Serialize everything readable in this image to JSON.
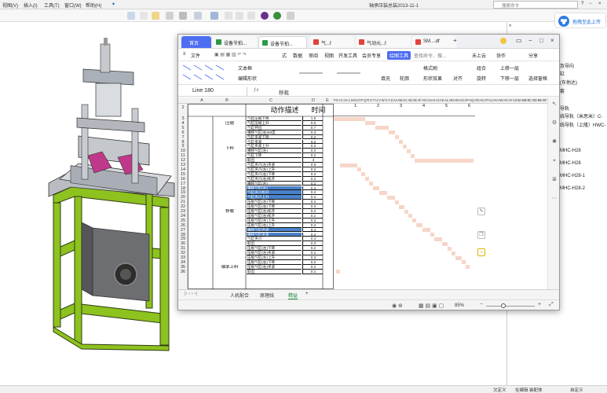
{
  "cad": {
    "menubar": {
      "items": [
        "视图(V)",
        "插入(I)",
        "工具(T)",
        "窗口(W)",
        "帮助(H)"
      ],
      "title": "轴承压装总装2013-11-1",
      "search_placeholder": "搜索命令"
    },
    "right_panel": {
      "upload_label": "拖拽至此上传",
      "tree_items": [
        "及导向",
        "缸",
        "(东他达)",
        "套",
        "导轨",
        "线导轨（米思米）C-",
        "线导轨（上隆）HWC-",
        "MHC-H28",
        "MHC-H28",
        "MHC-H28-1",
        "MHC-H28-2"
      ]
    },
    "statusbar": {
      "items": [
        "欠定义",
        "在编辑 装配体",
        "自定义"
      ]
    }
  },
  "wps": {
    "tabs": [
      {
        "label": "首页",
        "active": true
      },
      {
        "label": "设备节拍...",
        "color": "#2b9a49"
      },
      {
        "label": "设备节拍...",
        "color": "#2b9a49"
      },
      {
        "label": "气...f",
        "color": "#e0443a"
      },
      {
        "label": "气动元...f",
        "color": "#e0443a"
      },
      {
        "label": "SM....df",
        "color": "#e0443a"
      }
    ],
    "add_tab_label": "+",
    "menu": {
      "file": "文件",
      "items": [
        "式",
        "数据",
        "审阅",
        "视图",
        "开发工具",
        "会员专享"
      ],
      "drawing_tools": "绘图工具",
      "search_placeholder": "查找命令、搜...",
      "cloud": "未上云",
      "collab": "协作",
      "share": "分享"
    },
    "drawtools": {
      "textbox": "文本框",
      "edit_shape": "编辑形状",
      "fill": "填充",
      "outline": "轮廓",
      "format_painter": "格式刷",
      "shape_effect": "形状效果",
      "align": "对齐",
      "group": "组合",
      "rotate": "旋转",
      "bring_forward": "上移一层",
      "send_backward": "下移一层",
      "selection_pane": "选择窗格"
    },
    "formula_bar": {
      "name_box": "Line 180",
      "content": "移载"
    },
    "columns": [
      "A",
      "B",
      "C",
      "D",
      "E"
    ],
    "ruler_text": "FG H I J K L M N O P Q R S T U V W X Y Z AA AB AC AD AE AF AG AH AI AJ AK AL AM AN AO AP AQ AR AS AT AU AV AW AX AY AZ BA BB BC BD BE BF BG BH BI BJ BK BL BM BN BO BP BQ BR BS BT BU BV BW BX BY BZ CA CB CC CD CE CF CG CH CI CJ",
    "headers": {
      "action": "动作描述",
      "time": "时间"
    },
    "sections": [
      "压缩",
      "下料",
      "移载",
      "轴承上料"
    ],
    "rows": [
      {
        "n": "3",
        "desc": "气缸压缩下降",
        "time": "1.6"
      },
      {
        "n": "4",
        "desc": "气缸压缩上升",
        "time": "0.5"
      },
      {
        "n": "5",
        "desc": "气缸伸出",
        "time": "0.7"
      },
      {
        "n": "6",
        "desc": "横移气缸(右)90度",
        "time": "0.3"
      },
      {
        "n": "7",
        "desc": "气缸夹紧下降",
        "time": "0.2"
      },
      {
        "n": "8",
        "desc": "气缸夹紧",
        "time": "0.2"
      },
      {
        "n": "9",
        "desc": "气缸夹紧上升",
        "time": "0.2"
      },
      {
        "n": "10",
        "desc": "横移气缸(左)",
        "time": "0.2"
      },
      {
        "n": "11",
        "desc": "气缸下降",
        "time": "0.2"
      },
      {
        "n": "12",
        "desc": "取出",
        "time": "3"
      },
      {
        "n": "13",
        "desc": "气缸夹爪(左)夹紧",
        "time": "0.9"
      },
      {
        "n": "14",
        "desc": "气缸夹爪(左)上升",
        "time": "0.2"
      },
      {
        "n": "15",
        "desc": "气缸夹爪(右)下降",
        "time": "0.2"
      },
      {
        "n": "16",
        "desc": "气缸夹爪(右)松开",
        "time": "0.2"
      },
      {
        "n": "17",
        "desc": "横移气缸(右)",
        "time": "0.2"
      },
      {
        "n": "18",
        "desc": "横移气缸(左)",
        "time": "0.3",
        "highlight": true
      },
      {
        "n": "19",
        "desc": "气缸夹爪松开",
        "time": "0.4",
        "highlight": true
      },
      {
        "n": "20",
        "desc": "气缸夹爪上升",
        "time": "0.4",
        "highlight": true
      },
      {
        "n": "21",
        "desc": "压板气缸(左)下降",
        "time": "0.2"
      },
      {
        "n": "22",
        "desc": "压板气缸(右)下降",
        "time": "0.3"
      },
      {
        "n": "23",
        "desc": "压板气缸(左)松开",
        "time": "0.2"
      },
      {
        "n": "24",
        "desc": "压板气缸(右)松开",
        "time": "0.2"
      },
      {
        "n": "25",
        "desc": "压板气缸(左)上升",
        "time": "0.2"
      },
      {
        "n": "26",
        "desc": "压板气缸(右)上升",
        "time": "0.3"
      },
      {
        "n": "27",
        "desc": "横移气缸后退",
        "time": "0.4",
        "highlight": true
      },
      {
        "n": "28",
        "desc": "横移气缸夹紧",
        "time": "0.2",
        "highlight": true
      },
      {
        "n": "29",
        "desc": "气缸夹爪",
        "time": "0.4"
      },
      {
        "n": "30",
        "desc": "取出",
        "time": "0.3"
      },
      {
        "n": "31",
        "desc": "压板气缸(左)下降",
        "time": "0.2"
      },
      {
        "n": "32",
        "desc": "压板气缸(左)夹紧",
        "time": "0.2"
      },
      {
        "n": "33",
        "desc": "压板气缸(左)上升",
        "time": "0.3"
      },
      {
        "n": "34",
        "desc": "压板气缸(右)下降",
        "time": "0.2"
      },
      {
        "n": "35",
        "desc": "压板气缸(右)夹紧",
        "time": "0.2"
      },
      {
        "n": "36",
        "desc": "取出",
        "time": "0.2"
      }
    ],
    "gantt_scale": [
      "1",
      "2",
      "3",
      "4",
      "5",
      "6"
    ],
    "sheet_tabs": [
      "人机配合",
      "原理线",
      "精益"
    ],
    "add_sheet_label": "+",
    "zoom": "85%"
  }
}
